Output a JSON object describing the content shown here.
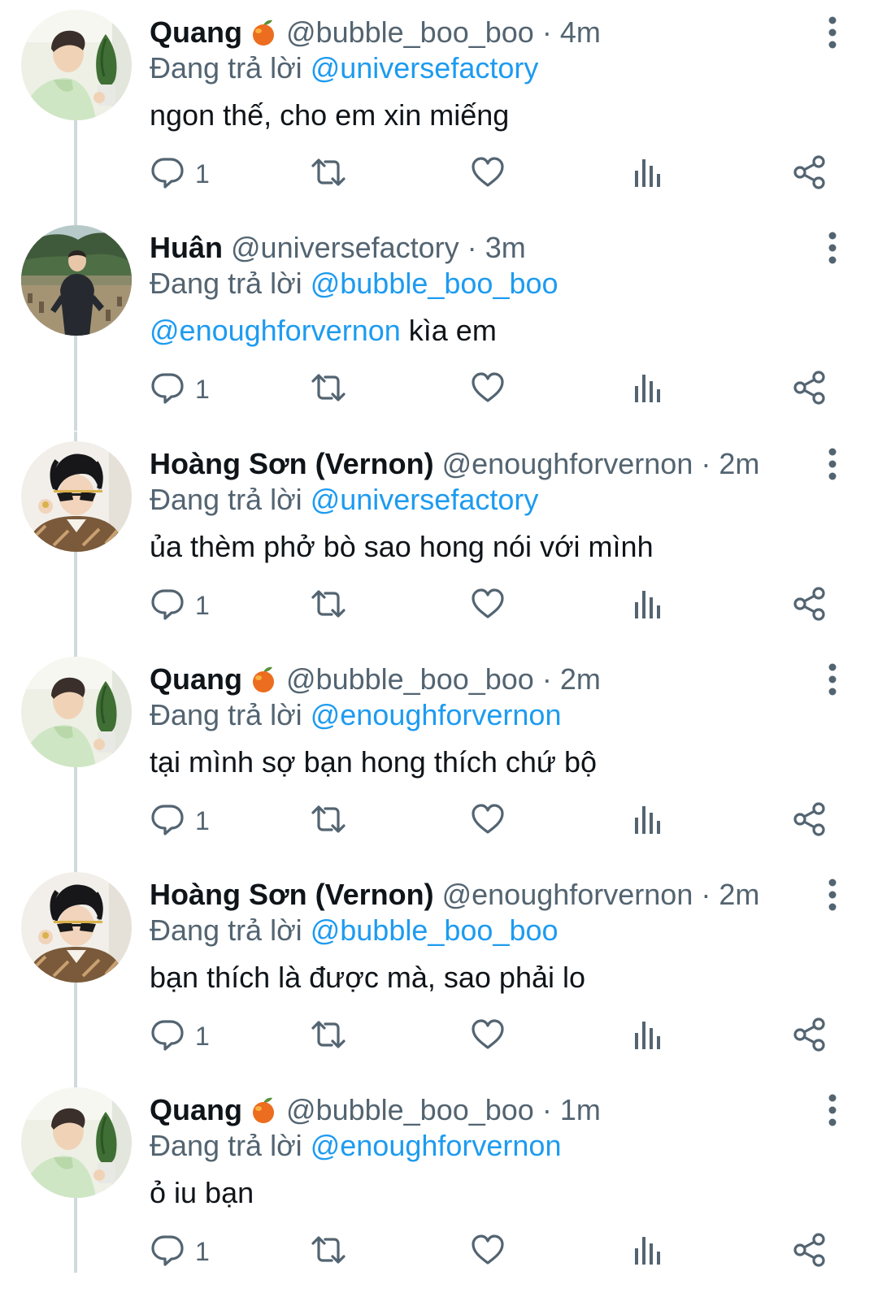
{
  "tweets": [
    {
      "name": "Quang",
      "has_emoji": true,
      "emoji_icon": "peach-icon",
      "handle": "@bubble_boo_boo",
      "separator": "·",
      "time": "4m",
      "replying_prefix": "Đang trả lời",
      "replying_to": "@universefactory",
      "body_mention": "",
      "body_text": "ngon thế, cho em xin miếng",
      "reply_count": "1",
      "avatar": "quang"
    },
    {
      "name": "Huân",
      "has_emoji": false,
      "handle": "@universefactory",
      "separator": "·",
      "time": "3m",
      "replying_prefix": "Đang trả lời",
      "replying_to": "@bubble_boo_boo",
      "body_mention": "@enoughforvernon",
      "body_text": " kìa em",
      "reply_count": "1",
      "avatar": "huan"
    },
    {
      "name": "Hoàng Sơn (Vernon)",
      "has_emoji": false,
      "handle": "@enoughforvernon",
      "separator": "·",
      "time": "2m",
      "replying_prefix": "Đang trả lời",
      "replying_to": "@universefactory",
      "body_mention": "",
      "body_text": "ủa thèm phở bò sao hong nói với mình",
      "reply_count": "1",
      "avatar": "vernon"
    },
    {
      "name": "Quang",
      "has_emoji": true,
      "emoji_icon": "peach-icon",
      "handle": "@bubble_boo_boo",
      "separator": "·",
      "time": "2m",
      "replying_prefix": "Đang trả lời",
      "replying_to": "@enoughforvernon",
      "body_mention": "",
      "body_text": "tại mình sợ bạn hong thích chứ bộ",
      "reply_count": "1",
      "avatar": "quang"
    },
    {
      "name": "Hoàng Sơn (Vernon)",
      "has_emoji": false,
      "handle": "@enoughforvernon",
      "separator": "·",
      "time": "2m",
      "replying_prefix": "Đang trả lời",
      "replying_to": "@bubble_boo_boo",
      "body_mention": "",
      "body_text": "bạn thích là được mà, sao phải lo",
      "reply_count": "1",
      "avatar": "vernon"
    },
    {
      "name": "Quang",
      "has_emoji": true,
      "emoji_icon": "peach-icon",
      "handle": "@bubble_boo_boo",
      "separator": "·",
      "time": "1m",
      "replying_prefix": "Đang trả lời",
      "replying_to": "@enoughforvernon",
      "body_mention": "",
      "body_text": "ỏ iu bạn",
      "reply_count": "1",
      "avatar": "quang"
    }
  ],
  "colors": {
    "text": "#0f1419",
    "secondary": "#536471",
    "link": "#1d9bf0",
    "thread_line": "#cfd9de"
  },
  "icons": {
    "reply": "reply-icon",
    "retweet": "retweet-icon",
    "like": "like-icon",
    "views": "views-icon",
    "share": "share-icon",
    "more": "more-icon"
  }
}
